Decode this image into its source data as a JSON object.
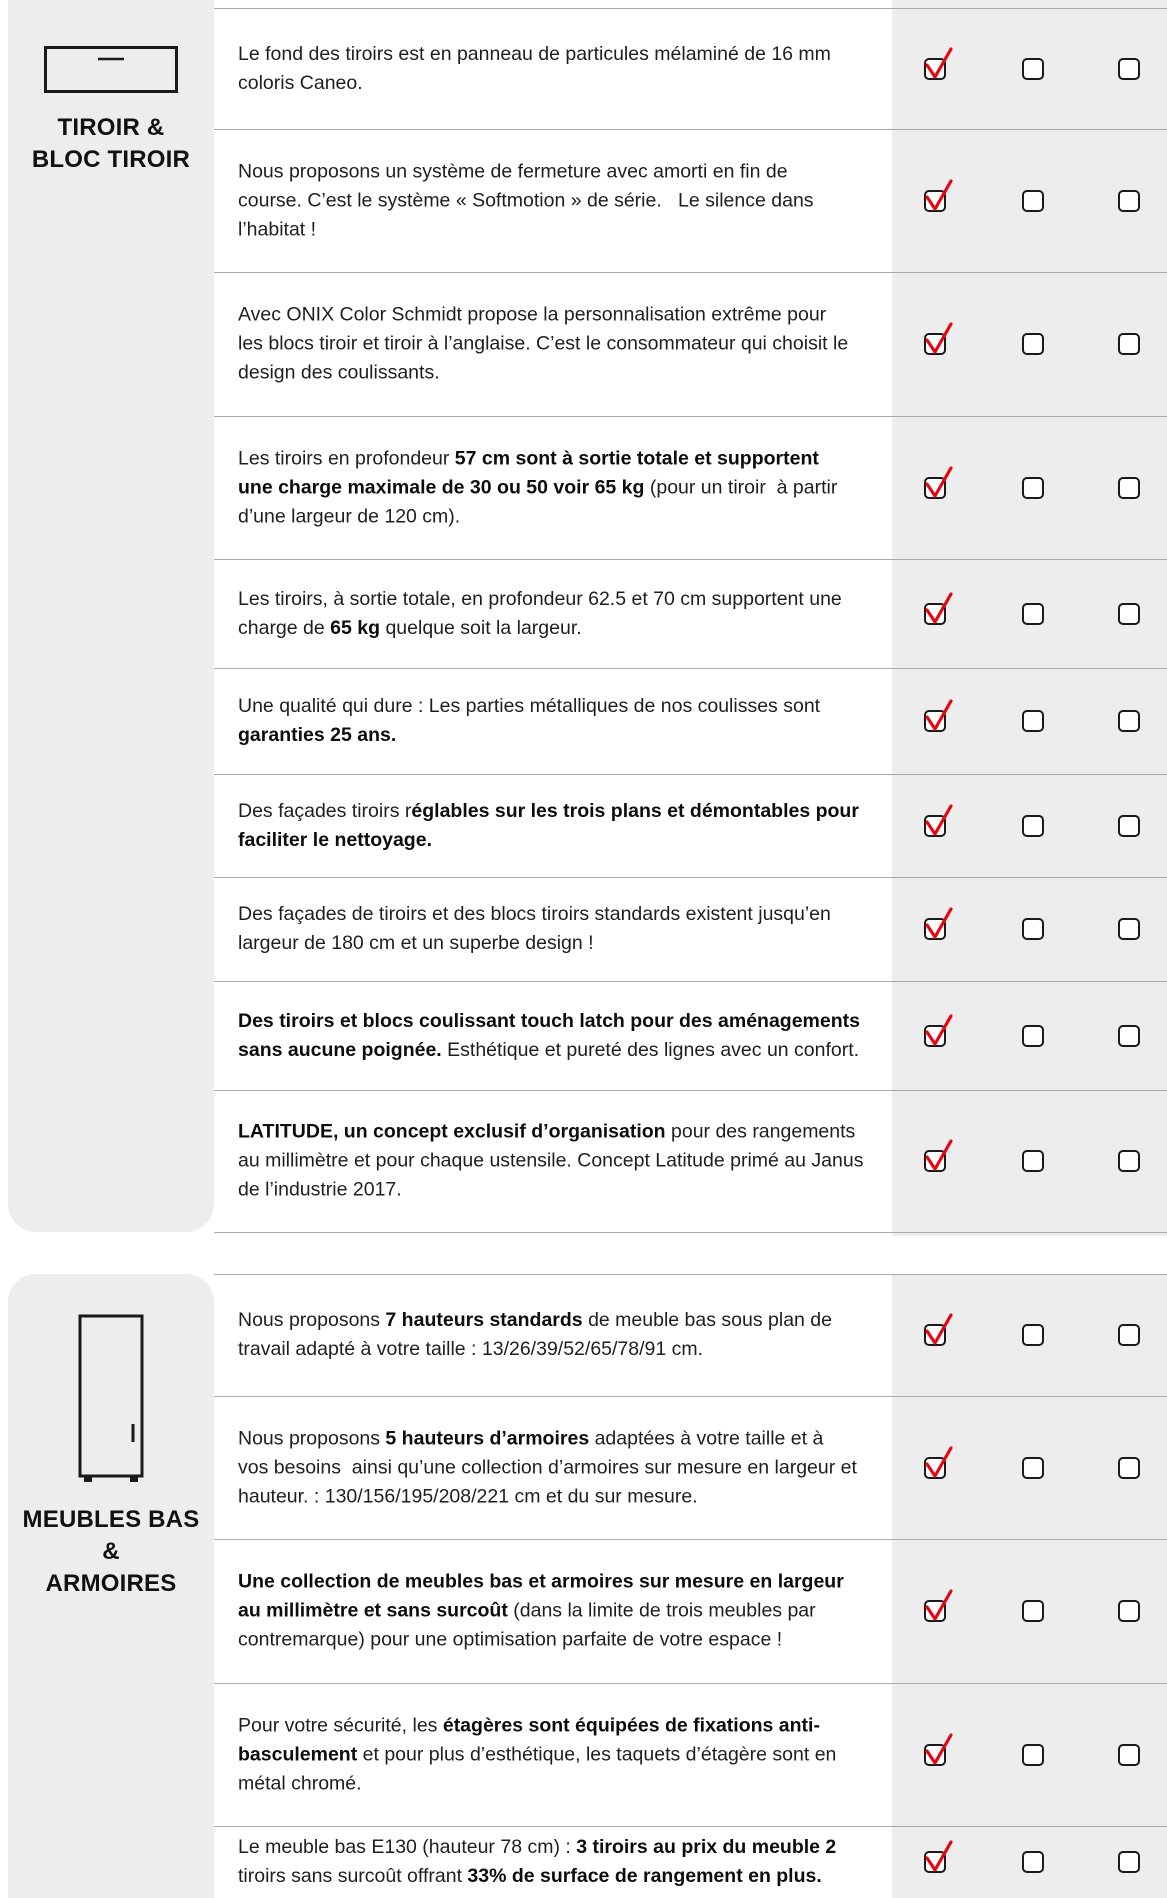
{
  "colors": {
    "panel": "#ededed",
    "check_red": "#e30613",
    "divider": "#a9a9a9"
  },
  "sections": [
    {
      "id": "tiroir",
      "icon": "drawer-icon",
      "title_lines": [
        "TIROIR &",
        "BLOC TIROIR"
      ],
      "rows": [
        {
          "html": "Le fond des tiroirs est en panneau de particules mélaminé de 16 mm<br>coloris Caneo.",
          "checks": [
            true,
            false,
            false
          ]
        },
        {
          "html": "Nous proposons un système de fermeture avec amorti en fin de<br>course. C’est le système « Softmotion » de série.&nbsp;&nbsp; Le silence dans<br>l’habitat !",
          "checks": [
            true,
            false,
            false
          ]
        },
        {
          "html": "Avec ONIX Color Schmidt propose la personnalisation extrême pour<br>les blocs tiroir et tiroir à l’anglaise. C’est le consommateur qui choisit le<br>design des coulissants.",
          "checks": [
            true,
            false,
            false
          ]
        },
        {
          "html": "Les tiroirs en profondeur <b>57 cm sont à sortie totale et supportent<br>une charge maximale de 30 ou 50 voir 65 kg</b> (pour un tiroir&nbsp; à partir<br>d’une largeur de 120 cm).",
          "checks": [
            true,
            false,
            false
          ]
        },
        {
          "html": "Les tiroirs, à sortie totale, en profondeur 62.5 et 70 cm supportent une<br>charge de <b>65 kg</b> quelque soit la largeur.",
          "checks": [
            true,
            false,
            false
          ]
        },
        {
          "html": "Une qualité qui dure : Les parties métalliques de nos coulisses sont<br><b>garanties 25 ans.</b>",
          "checks": [
            true,
            false,
            false
          ]
        },
        {
          "html": "Des façades tiroirs r<b>églables sur les trois plans et démontables pour<br>faciliter le nettoyage.</b>",
          "checks": [
            true,
            false,
            false
          ]
        },
        {
          "html": "Des façades de tiroirs et des blocs tiroirs standards existent jusqu’en<br>largeur de 180 cm et un superbe design !",
          "checks": [
            true,
            false,
            false
          ]
        },
        {
          "html": "<b>Des tiroirs et blocs coulissant touch latch pour des aménagements<br>sans aucune poignée.</b> Esthétique et pureté des lignes avec un confort.",
          "checks": [
            true,
            false,
            false
          ]
        },
        {
          "html": "<b>LATITUDE, un concept exclusif d’organisation</b> pour des rangements<br>au millimètre et pour chaque ustensile. Concept Latitude primé au Janus<br>de l’industrie 2017.",
          "checks": [
            true,
            false,
            false
          ]
        }
      ]
    },
    {
      "id": "meubles",
      "icon": "cabinet-icon",
      "title_lines": [
        "MEUBLES BAS",
        "&",
        "ARMOIRES"
      ],
      "rows": [
        {
          "html": "Nous proposons <b>7 hauteurs standards</b> de meuble bas sous plan de<br>travail adapté à votre taille : 13/26/39/52/65/78/91 cm.",
          "checks": [
            true,
            false,
            false
          ]
        },
        {
          "html": "Nous proposons <b>5 hauteurs d’armoires</b> adaptées à votre taille et à<br>vos besoins&nbsp; ainsi qu’une collection d’armoires sur mesure en largeur et<br>hauteur. : 130/156/195/208/221 cm et du sur mesure.",
          "checks": [
            true,
            false,
            false
          ]
        },
        {
          "html": "<b>Une collection de meubles bas et armoires sur mesure en largeur<br>au millimètre et sans surcoût</b> (dans la limite de trois meubles par<br>contremarque) pour une optimisation parfaite de votre espace !",
          "checks": [
            true,
            false,
            false
          ]
        },
        {
          "html": "Pour votre sécurité, les <b>étagères sont équipées de fixations anti-<br>basculement</b> et pour plus d’esthétique, les taquets d’étagère sont en<br>métal chromé.",
          "checks": [
            true,
            false,
            false
          ]
        },
        {
          "html": "Le meuble bas E130 (hauteur 78 cm) : <b>3 tiroirs au prix du meuble 2<br></b>tiroirs sans surcoût offrant <b>33% de surface de rangement en plus.</b>",
          "checks": [
            true,
            false,
            false
          ]
        }
      ]
    }
  ]
}
